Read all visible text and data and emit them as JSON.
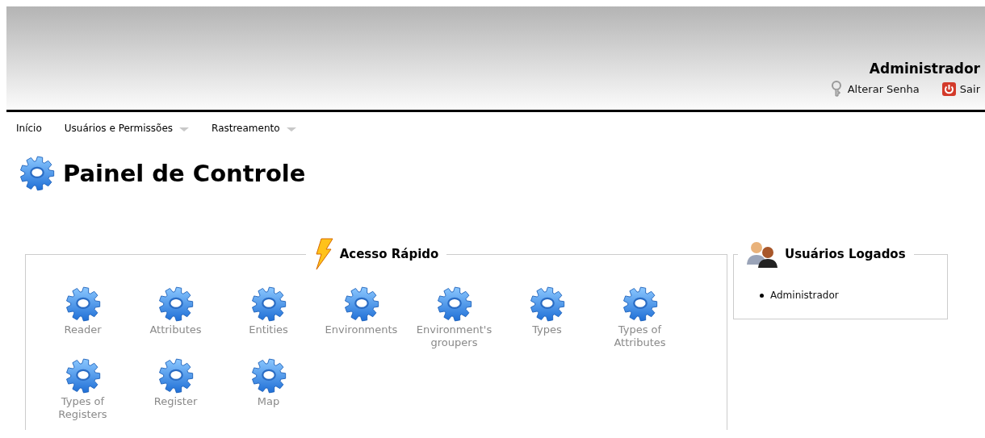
{
  "header": {
    "user": "Administrador",
    "links": [
      {
        "kind": "key",
        "label": "Alterar Senha"
      },
      {
        "kind": "power",
        "label": "Sair"
      }
    ]
  },
  "menu": [
    {
      "label": "Início",
      "dropdown": false
    },
    {
      "label": "Usuários e Permissões",
      "dropdown": true
    },
    {
      "label": "Rastreamento",
      "dropdown": true
    }
  ],
  "page_title": "Painel de Controle",
  "quick_access": {
    "title": "Acesso Rápido",
    "items": [
      {
        "label": "Reader"
      },
      {
        "label": "Attributes"
      },
      {
        "label": "Entities"
      },
      {
        "label": "Environments"
      },
      {
        "label": "Environment's groupers"
      },
      {
        "label": "Types"
      },
      {
        "label": "Types of Attributes"
      },
      {
        "label": "Types of Registers"
      },
      {
        "label": "Register"
      },
      {
        "label": "Map"
      }
    ]
  },
  "logged_users": {
    "title": "Usuários Logados",
    "users": [
      "Administrador"
    ]
  }
}
